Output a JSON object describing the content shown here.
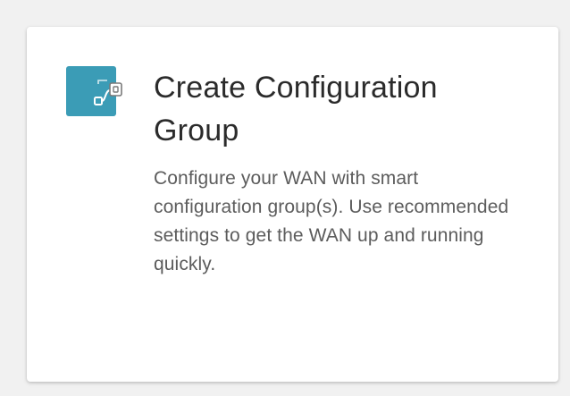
{
  "card": {
    "title": "Create Configuration Group",
    "description": "Configure your WAN with smart configuration group(s). Use recommended settings to get the WAN up and running quickly.",
    "icon": "workflow-icon"
  },
  "colors": {
    "accent": "#3b9cb6",
    "title_text": "#2b2b2b",
    "body_text": "#5c5c5c",
    "card_bg": "#ffffff",
    "page_bg": "#f1f1f1"
  }
}
